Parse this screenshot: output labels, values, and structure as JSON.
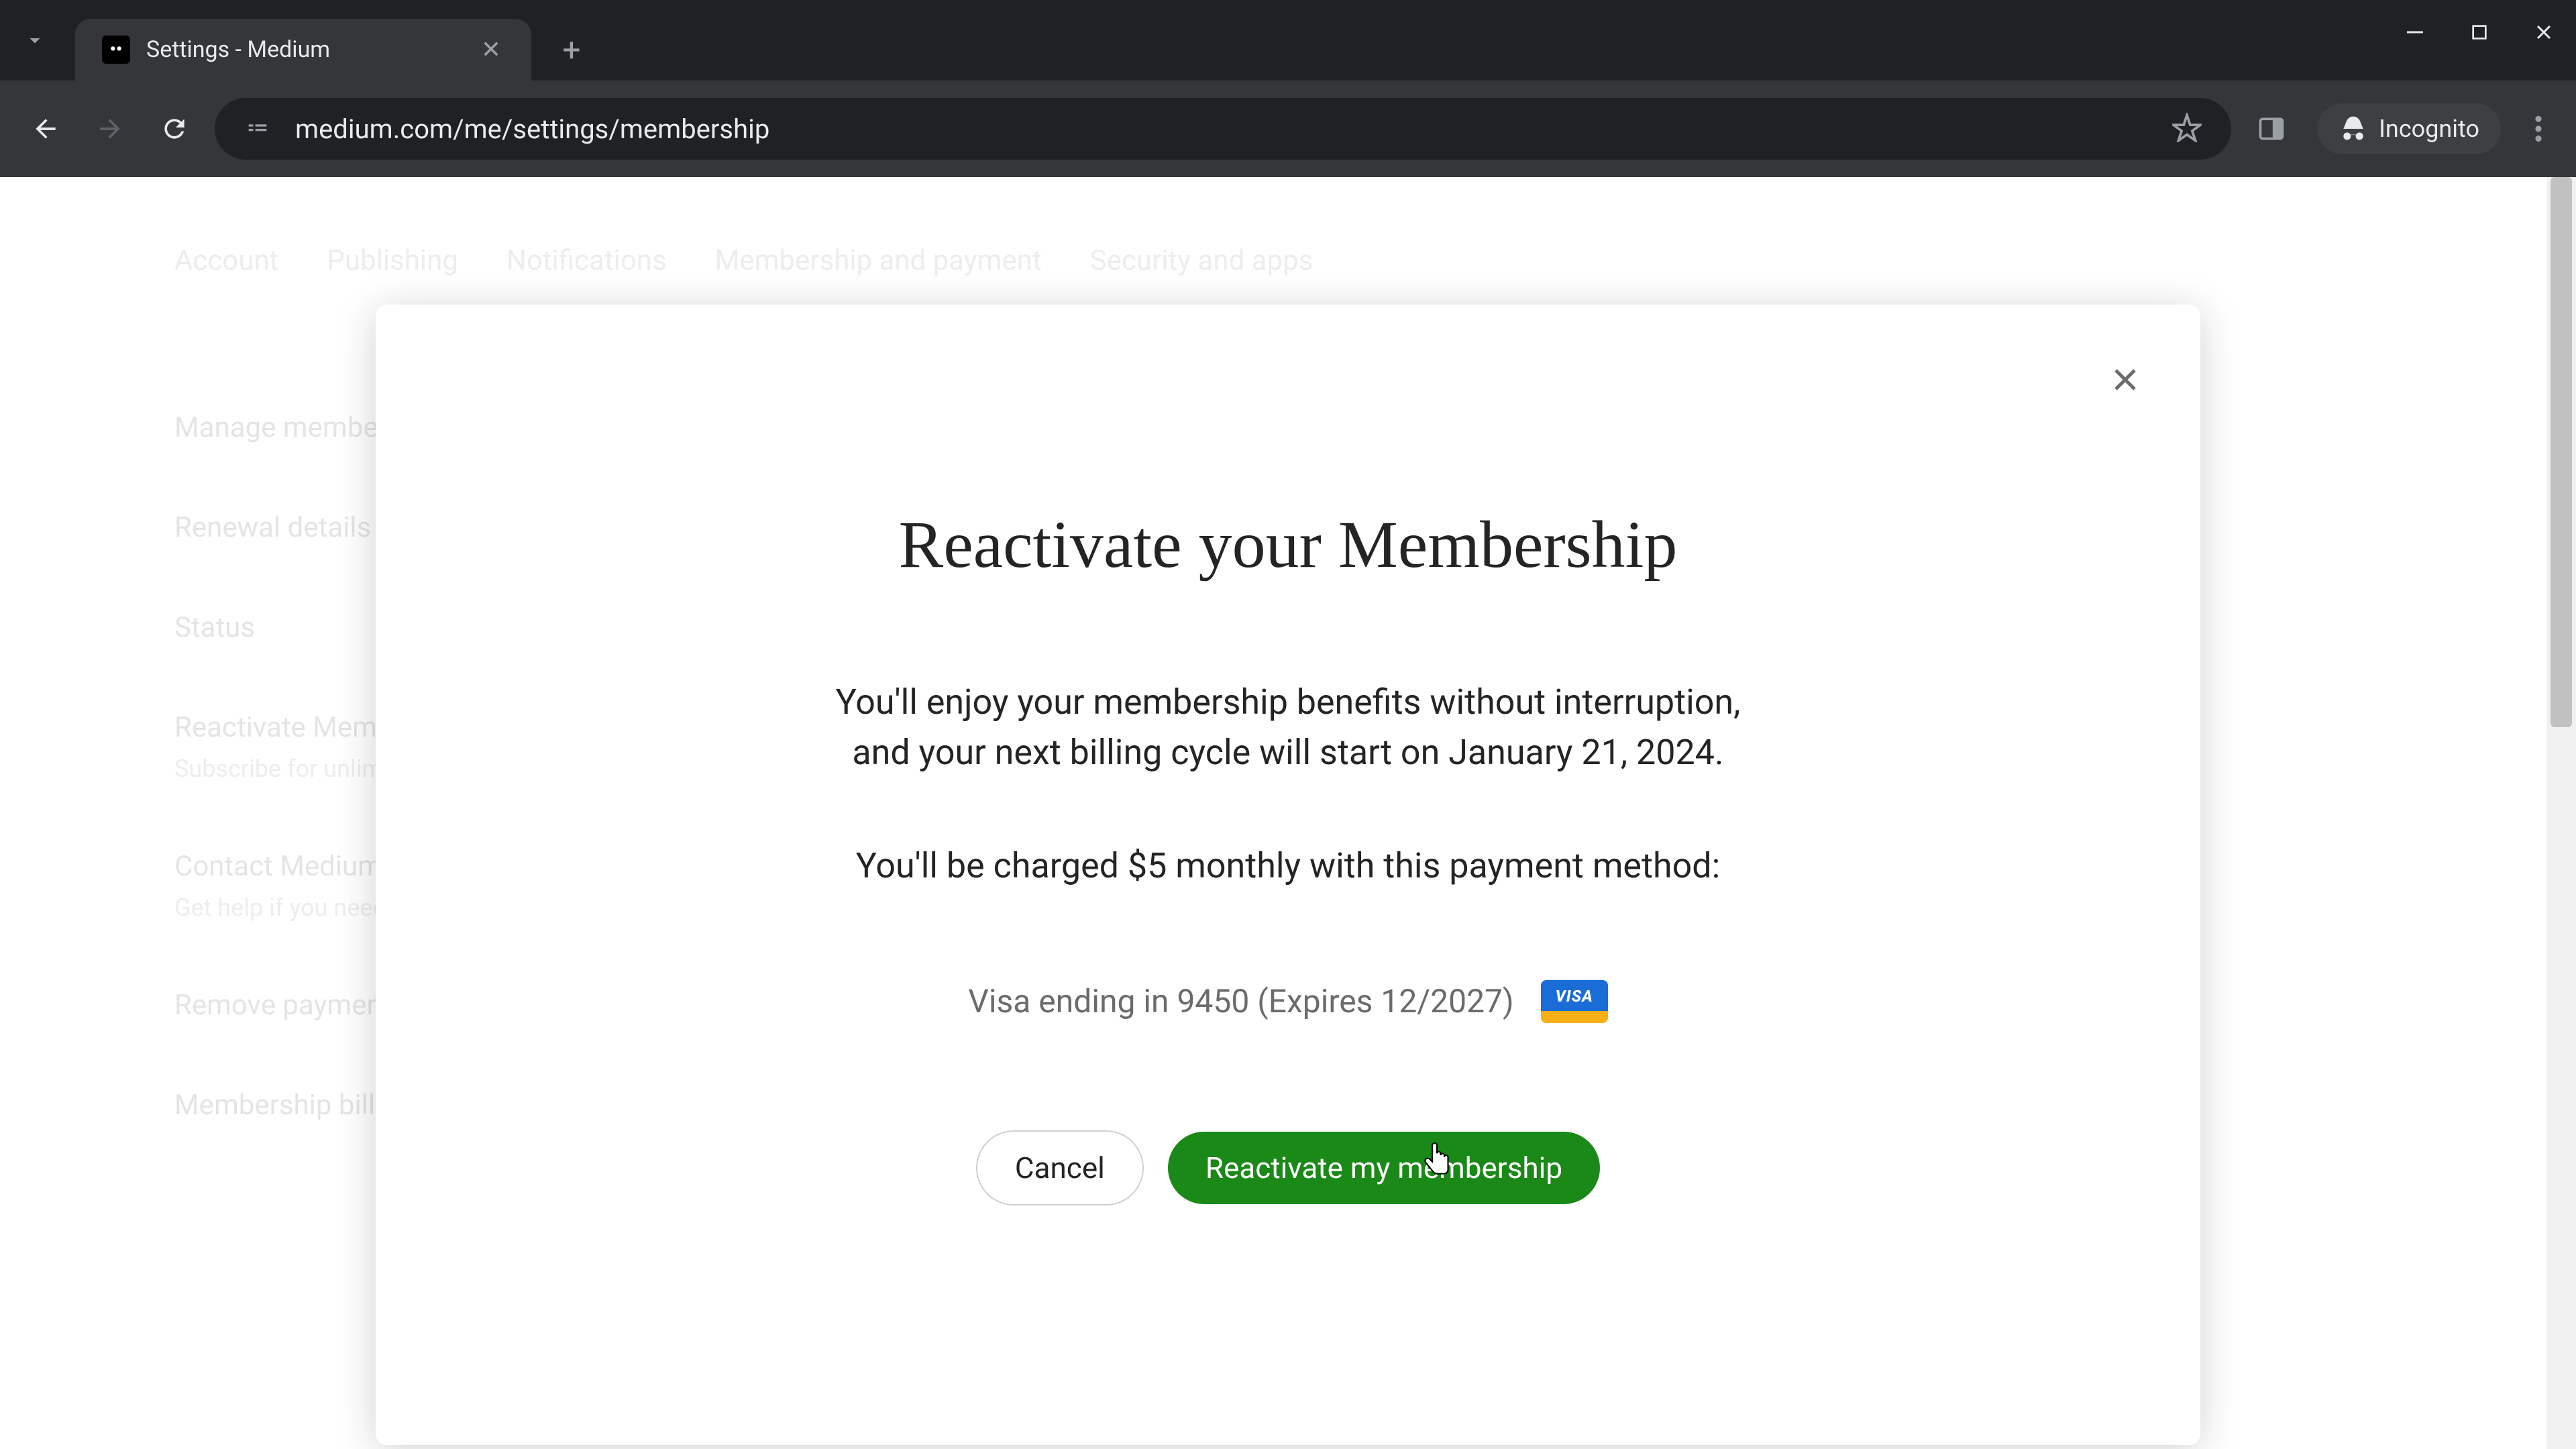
{
  "browser": {
    "tab_title": "Settings - Medium",
    "url": "medium.com/me/settings/membership",
    "incognito_label": "Incognito"
  },
  "page": {
    "nav_tabs": {
      "account": "Account",
      "publishing": "Publishing",
      "notifications": "Notifications",
      "membership": "Membership and payment",
      "security": "Security and apps"
    },
    "sections": {
      "manage": "Manage membership",
      "renewal": "Renewal details",
      "status": "Status",
      "reactivate": "Reactivate Membership",
      "reactivate_sub": "Subscribe for unlimited access",
      "contact": "Contact Medium",
      "contact_sub": "Get help if you need it",
      "remove": "Remove payment",
      "billing": "Membership billing"
    }
  },
  "modal": {
    "title": "Reactivate your Membership",
    "desc": "You'll enjoy your membership benefits without interruption, and your next billing cycle will start on January 21, 2024.",
    "charge_line": "You'll be charged $5 monthly with this payment method:",
    "payment_method": "Visa ending in 9450 (Expires 12/2027)",
    "card_brand": "VISA",
    "cancel_label": "Cancel",
    "confirm_label": "Reactivate my membership"
  }
}
